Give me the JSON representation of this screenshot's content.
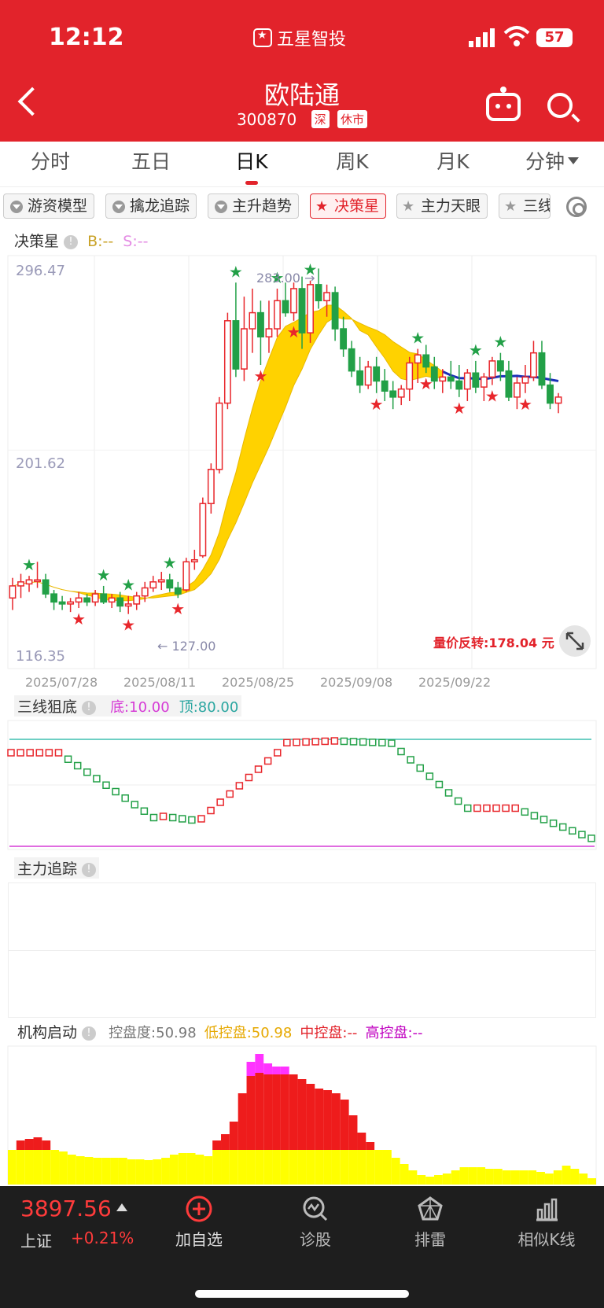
{
  "status": {
    "time": "12:12",
    "app_name": "五星智投",
    "battery": "57"
  },
  "header": {
    "title": "欧陆通",
    "code": "300870",
    "tags": [
      "深",
      "休市"
    ]
  },
  "period_tabs": [
    "分时",
    "五日",
    "日K",
    "周K",
    "月K",
    "分钟"
  ],
  "active_tab": "日K",
  "indicator_chips": [
    "游资模型",
    "擒龙追踪",
    "主升趋势",
    "决策星",
    "主力天眼",
    "三线"
  ],
  "active_chip": "决策星",
  "main_panel": {
    "label": "决策星",
    "b_text": "B:--",
    "s_text": "S:--",
    "price_labels": [
      "296.47",
      "201.62",
      "116.35"
    ],
    "high_mark": "283.00 →",
    "low_mark": "← 127.00",
    "reversal_text": "量价反转:178.04 元",
    "dates": [
      "2025/07/28",
      "2025/08/11",
      "2025/08/25",
      "2025/09/08",
      "2025/09/22"
    ]
  },
  "three_line_panel": {
    "label": "三线狙底",
    "bottom_text": "底:10.00",
    "top_text": "顶:80.00"
  },
  "main_track_panel": {
    "label": "主力追踪"
  },
  "institution_panel": {
    "label": "机构启动",
    "control_degree": "控盘度:50.98",
    "low_control": "低控盘:50.98",
    "mid_control": "中控盘:--",
    "high_control": "高控盘:--"
  },
  "bottom_bar": {
    "index_price": "3897.56",
    "index_name": "上证",
    "index_change": "+0.21%",
    "nav": [
      "加自选",
      "诊股",
      "排雷",
      "相似K线"
    ]
  },
  "colors": {
    "brand_red": "#e2232b",
    "candle_up": "#e8262b",
    "candle_down": "#22a047",
    "band": "#ffd200",
    "low_control": "#ffff00",
    "high_control": "#ff33ff",
    "teal_line": "#3fbfb0",
    "magenta_line": "#d63bd6"
  },
  "chart_data": [
    {
      "type": "candlestick",
      "title": "决策星",
      "ylim": [
        116.35,
        296.47
      ],
      "x_ticks": [
        "2025/07/28",
        "2025/08/11",
        "2025/08/25",
        "2025/09/08",
        "2025/09/22"
      ],
      "ohlc": [
        [
          128,
          138,
          122,
          134
        ],
        [
          134,
          140,
          128,
          136
        ],
        [
          135,
          139,
          131,
          137
        ],
        [
          137,
          146,
          133,
          137
        ],
        [
          137,
          140,
          128,
          130
        ],
        [
          130,
          132,
          122,
          126
        ],
        [
          126,
          129,
          122,
          125
        ],
        [
          125,
          128,
          121,
          126
        ],
        [
          126,
          131,
          123,
          128
        ],
        [
          128,
          130,
          124,
          126
        ],
        [
          126,
          132,
          124,
          130
        ],
        [
          130,
          134,
          125,
          126
        ],
        [
          126,
          130,
          123,
          128
        ],
        [
          128,
          131,
          121,
          124
        ],
        [
          124,
          129,
          120,
          125
        ],
        [
          125,
          131,
          122,
          129
        ],
        [
          129,
          136,
          126,
          133
        ],
        [
          133,
          139,
          131,
          136
        ],
        [
          136,
          141,
          132,
          137
        ],
        [
          137,
          140,
          131,
          133
        ],
        [
          133,
          136,
          128,
          130
        ],
        [
          132,
          148,
          131,
          146
        ],
        [
          146,
          152,
          142,
          147
        ],
        [
          149,
          178,
          148,
          175
        ],
        [
          175,
          195,
          170,
          192
        ],
        [
          192,
          228,
          190,
          225
        ],
        [
          225,
          270,
          222,
          266
        ],
        [
          266,
          285,
          238,
          242
        ],
        [
          242,
          278,
          236,
          262
        ],
        [
          262,
          282,
          250,
          270
        ],
        [
          270,
          276,
          244,
          258
        ],
        [
          258,
          276,
          250,
          262
        ],
        [
          262,
          282,
          258,
          276
        ],
        [
          276,
          285,
          268,
          270
        ],
        [
          270,
          285,
          266,
          282
        ],
        [
          282,
          288,
          252,
          260
        ],
        [
          260,
          286,
          255,
          284
        ],
        [
          284,
          292,
          272,
          276
        ],
        [
          276,
          284,
          268,
          280
        ],
        [
          280,
          283,
          256,
          262
        ],
        [
          262,
          268,
          248,
          252
        ],
        [
          252,
          256,
          238,
          241
        ],
        [
          241,
          248,
          230,
          234
        ],
        [
          234,
          246,
          232,
          243
        ],
        [
          243,
          248,
          230,
          236
        ],
        [
          236,
          242,
          226,
          231
        ],
        [
          231,
          236,
          222,
          228
        ],
        [
          228,
          234,
          224,
          232
        ],
        [
          232,
          248,
          226,
          245
        ],
        [
          245,
          252,
          235,
          249
        ],
        [
          249,
          254,
          240,
          243
        ],
        [
          243,
          248,
          232,
          236
        ],
        [
          236,
          242,
          230,
          238
        ],
        [
          238,
          246,
          232,
          236
        ],
        [
          236,
          244,
          228,
          232
        ],
        [
          232,
          242,
          226,
          240
        ],
        [
          240,
          246,
          230,
          233
        ],
        [
          233,
          240,
          226,
          238
        ],
        [
          238,
          248,
          234,
          246
        ],
        [
          246,
          250,
          236,
          241
        ],
        [
          241,
          246,
          226,
          228
        ],
        [
          228,
          238,
          222,
          235
        ],
        [
          235,
          244,
          230,
          238
        ],
        [
          238,
          256,
          236,
          250
        ],
        [
          250,
          256,
          232,
          234
        ],
        [
          234,
          240,
          222,
          225
        ],
        [
          225,
          230,
          220,
          228
        ]
      ]
    },
    {
      "type": "line",
      "title": "三线狙底",
      "reference_lines": [
        10,
        80
      ]
    },
    {
      "type": "bar",
      "title": "机构启动",
      "series": [
        {
          "name": "低控盘",
          "value": 50.98
        },
        {
          "name": "中控盘",
          "value": null
        },
        {
          "name": "高控盘",
          "value": null
        }
      ]
    }
  ]
}
